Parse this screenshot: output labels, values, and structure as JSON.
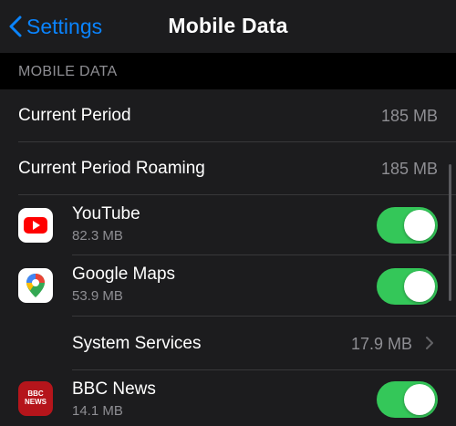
{
  "navbar": {
    "back_label": "Settings",
    "title": "Mobile Data"
  },
  "section": {
    "header": "MOBILE DATA"
  },
  "summary_rows": [
    {
      "label": "Current Period",
      "value": "185 MB"
    },
    {
      "label": "Current Period Roaming",
      "value": "185 MB"
    }
  ],
  "apps": [
    {
      "name": "YouTube",
      "usage": "82.3 MB",
      "icon": "youtube-icon",
      "enabled": true
    },
    {
      "name": "Google Maps",
      "usage": "53.9 MB",
      "icon": "google-maps-icon",
      "enabled": true
    },
    {
      "name": "BBC News",
      "usage": "14.1 MB",
      "icon": "bbc-news-icon",
      "enabled": true
    }
  ],
  "system_services": {
    "label": "System Services",
    "value": "17.9 MB"
  },
  "bbc_icon_text": {
    "line1": "BBC",
    "line2": "NEWS"
  },
  "colors": {
    "accent": "#0a84ff",
    "toggle_on": "#34c759",
    "background": "#000000",
    "cell": "#1c1c1e",
    "secondary_text": "#8e8e93"
  }
}
